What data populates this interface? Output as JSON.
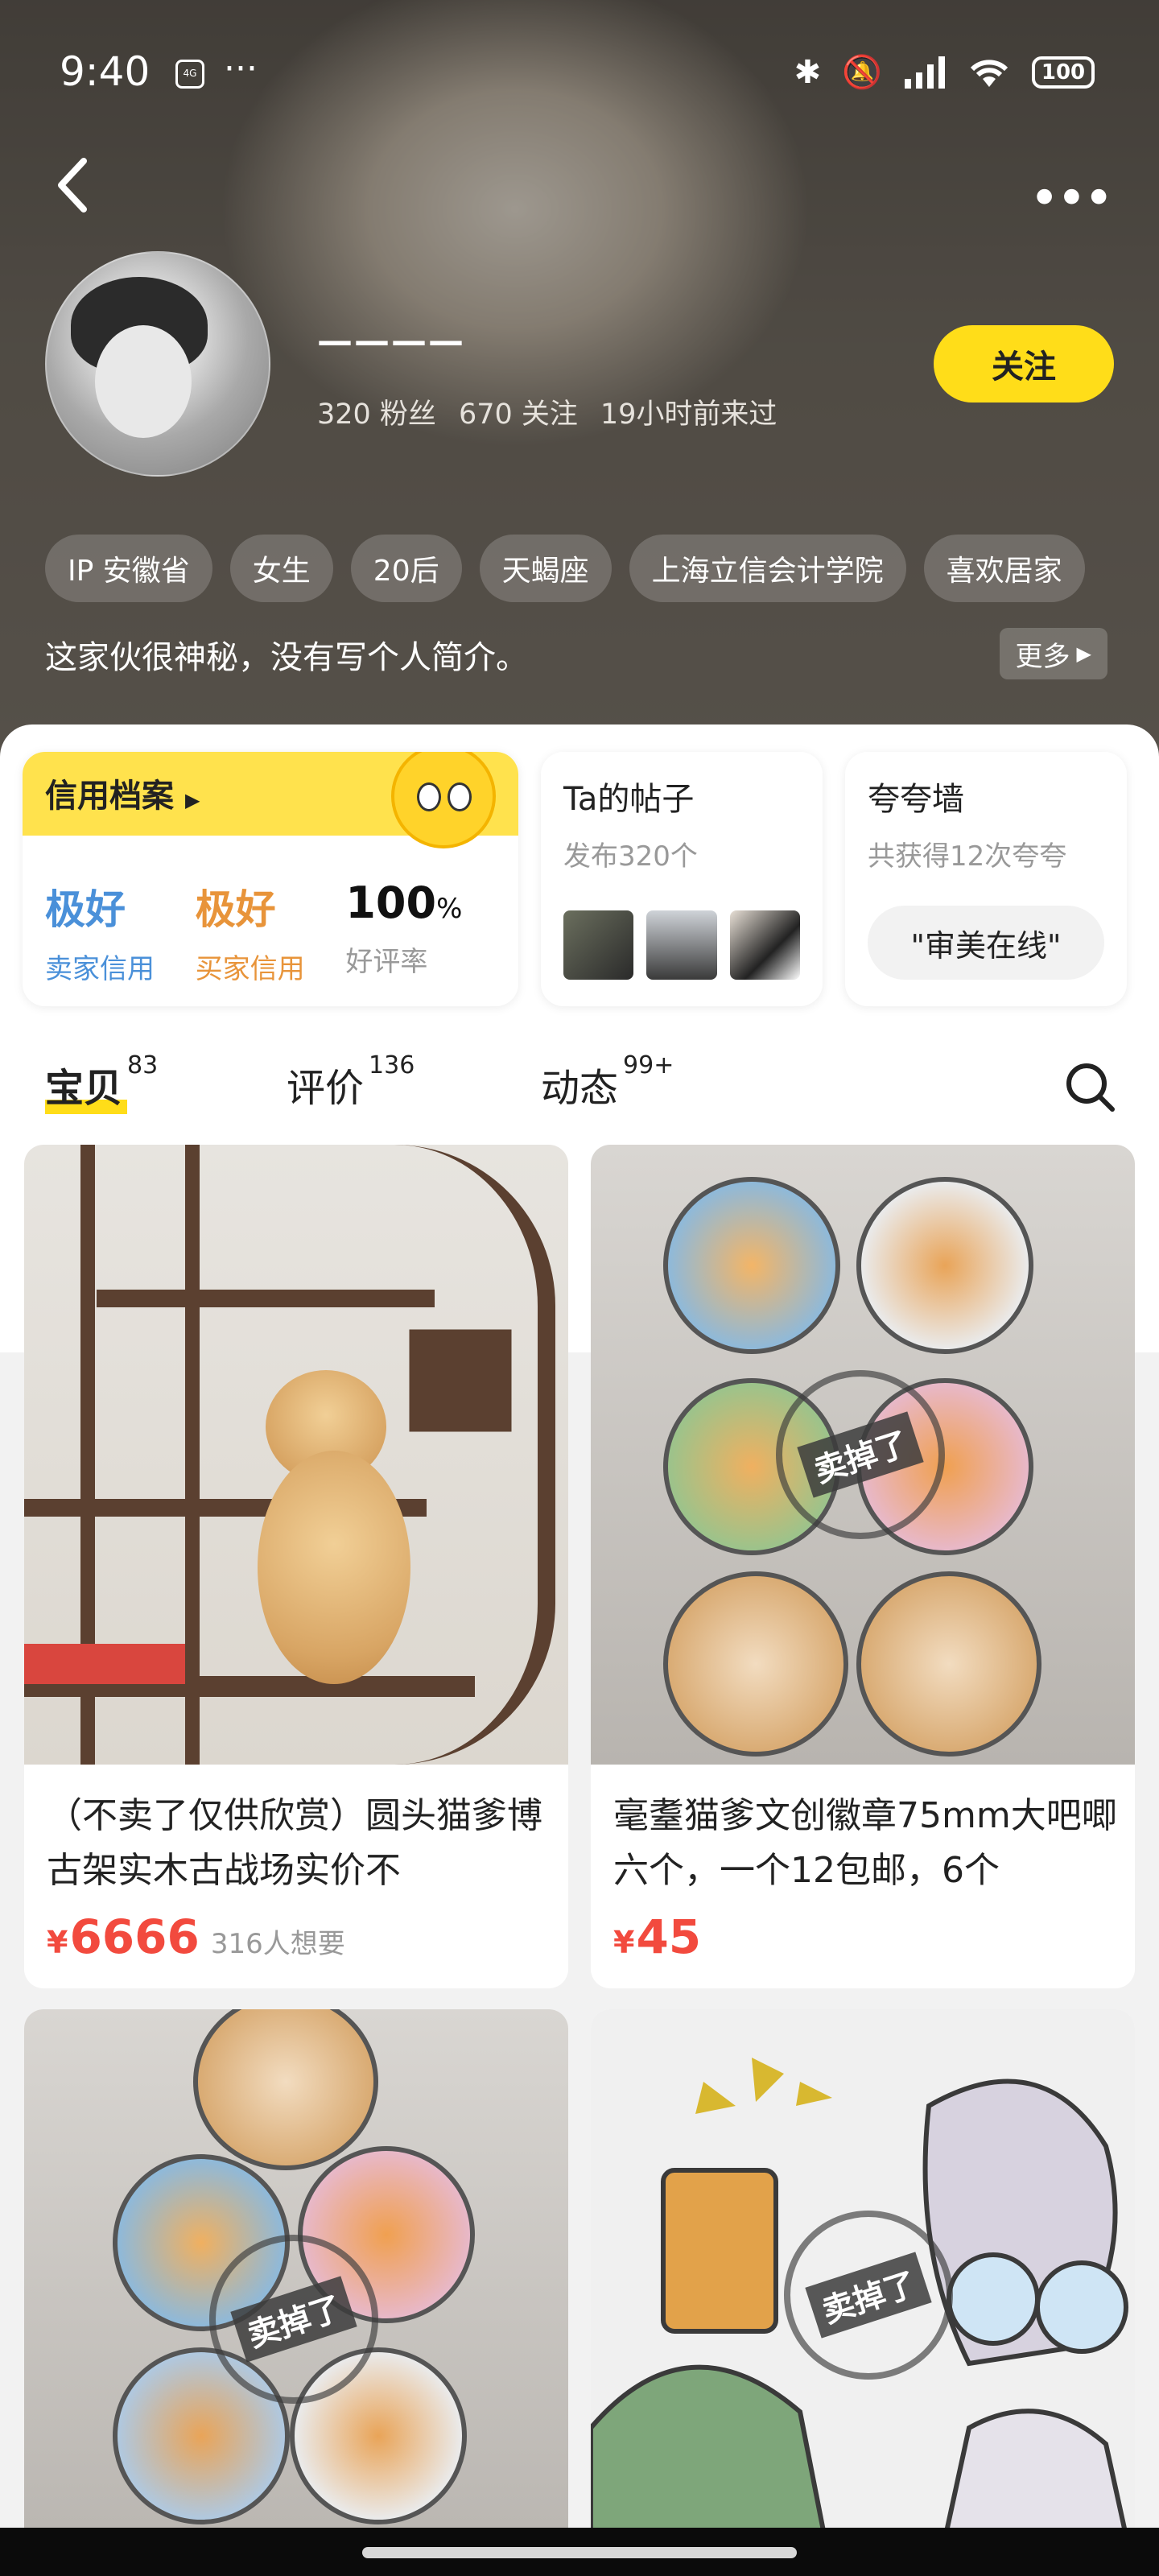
{
  "status_bar": {
    "time": "9:40",
    "carrier_badge": "4G",
    "dots": "···",
    "battery": "100"
  },
  "profile": {
    "name": "————",
    "fans": "320 粉丝",
    "following": "670 关注",
    "last_seen": "19小时前来过",
    "follow_label": "关注",
    "tags": [
      "IP 安徽省",
      "女生",
      "20后",
      "天蝎座",
      "上海立信会计学院",
      "喜欢居家"
    ],
    "bio": "这家伙很神秘，没有写个人简介。",
    "more_label": "更多"
  },
  "credit": {
    "title": "信用档案",
    "seller_value": "极好",
    "seller_label": "卖家信用",
    "buyer_value": "极好",
    "buyer_label": "买家信用",
    "rating_value": "100",
    "rating_unit": "%",
    "rating_label": "好评率"
  },
  "posts_card": {
    "title": "Ta的帖子",
    "subtitle": "发布320个"
  },
  "praise_card": {
    "title": "夸夸墙",
    "subtitle": "共获得12次夸夸",
    "chip": "\"审美在线\""
  },
  "tabs": [
    {
      "label": "宝贝",
      "count": "83"
    },
    {
      "label": "评价",
      "count": "136"
    },
    {
      "label": "动态",
      "count": "99+"
    }
  ],
  "products": [
    {
      "title": "（不卖了仅供欣赏）圆头猫爹博古架实木古战场实价不",
      "currency": "¥",
      "price": "6666",
      "wants": "316人想要"
    },
    {
      "title": "毫耋猫爹文创徽章75mm大吧唧六个，一个12包邮，6个",
      "currency": "¥",
      "price": "45",
      "wants": ""
    },
    {
      "title": "",
      "currency": "",
      "price": "",
      "wants": ""
    },
    {
      "title": "",
      "currency": "",
      "price": "",
      "wants": ""
    }
  ],
  "sold_stamp": "卖掉了",
  "colors": {
    "accent": "#ffdd19",
    "price": "#f24a3e",
    "seller": "#4a90d9",
    "buyer": "#e8943a"
  }
}
